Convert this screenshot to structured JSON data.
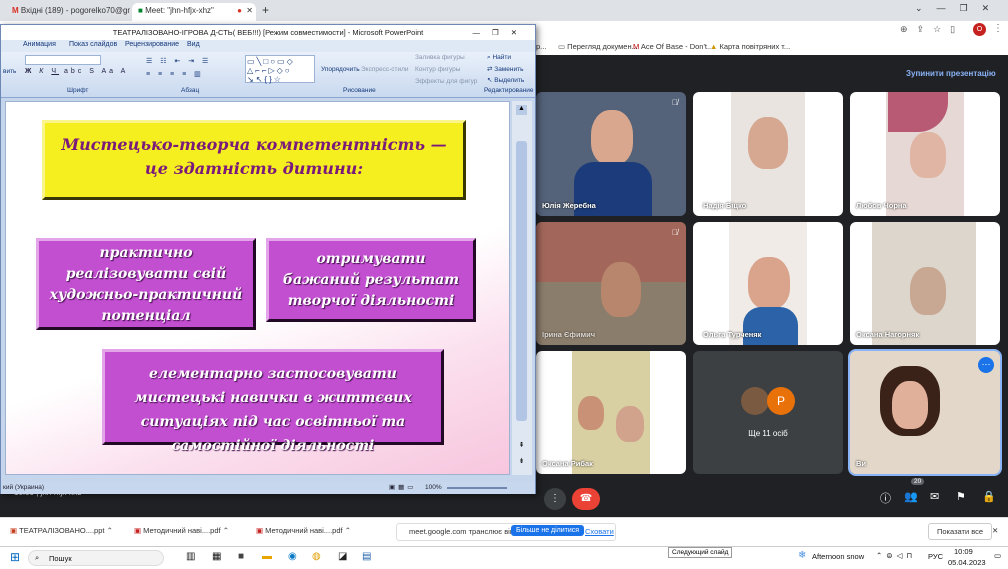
{
  "browser": {
    "tabs": [
      {
        "label": "Вхідні (189) - pogorelko70@gm..."
      },
      {
        "label": "Meet: \"jhn-hfjx-xhz\""
      }
    ],
    "new_tab": "+",
    "window_controls": [
      "⌄",
      "—",
      "❐",
      "✕"
    ],
    "bookmarks": [
      {
        "label": "р..."
      },
      {
        "label": "Перегляд докумен..."
      },
      {
        "label": "Ace Of Base - Don't..."
      },
      {
        "label": "Карта повітряних т..."
      }
    ],
    "avatar_letter": "O"
  },
  "meet": {
    "stop_presenting": "Зупинити презентацію",
    "participants": [
      {
        "name": "Юлія Жеребна"
      },
      {
        "name": "Надія Біцко"
      },
      {
        "name": "Любов Чорна"
      },
      {
        "name": "Ірина Єфимич"
      },
      {
        "name": "Ольга Турченяк"
      },
      {
        "name": "Оксана Нагорняк"
      },
      {
        "name": "Оксана Рибак"
      },
      {
        "name": "Ще 11 осіб"
      },
      {
        "name": "Ви"
      }
    ],
    "others_avatar_letter": "P",
    "time_code": "10:09 | jhn-hfjx-xhz",
    "participant_count": "20"
  },
  "ppt": {
    "title": "ТЕАТРАЛІЗОВАНО-ІГРОВА Д-СТЬ( ВЕБ!!!) [Режим совместимости] - Microsoft PowerPoint",
    "menu": [
      "Анимация",
      "Показ слайдов",
      "Рецензирование",
      "Вид"
    ],
    "ribbon_groups": [
      "Шрифт",
      "Абзац",
      "Рисование",
      "Редактирование"
    ],
    "ribbon_items": {
      "arrange": "Упорядочить",
      "express": "Экспресс-стили",
      "fill": "Заливка фигуры",
      "outline": "Контур фигуры",
      "effects": "Эффекты для фигур",
      "find": "Найти",
      "replace": "Заменить",
      "select": "Выделить",
      "left_cut": "вить"
    },
    "slide": {
      "title_box": "Мистецько-творча компетентність — це здатність дитини:",
      "box1": "практично реалізовувати свій художньо-практичний потенціал",
      "box2": "отримувати бажаний результат творчої діяльності",
      "box3": "елементарно застосовувати мистецькі навички в життєвих ситуаціях під час освітньої та самостійної діяльності"
    },
    "status_lang": "кий (Украина)",
    "zoom": "100%"
  },
  "downloads": {
    "items": [
      {
        "label": "ТЕАТРАЛІЗОВАНО....ppt"
      },
      {
        "label": "Методичний наві....pdf"
      },
      {
        "label": "Методичний наві....pdf"
      }
    ],
    "share_notice": "meet.google.com транслює вікно.",
    "stop_share": "Більше не ділитися",
    "hide": "Сховати",
    "show_all": "Показати все"
  },
  "taskbar": {
    "search": "Пошук",
    "tooltip": "Следующий слайд",
    "weather": "Afternoon snow",
    "lang": "РУС",
    "time": "10:09",
    "date": "05.04.2023"
  }
}
